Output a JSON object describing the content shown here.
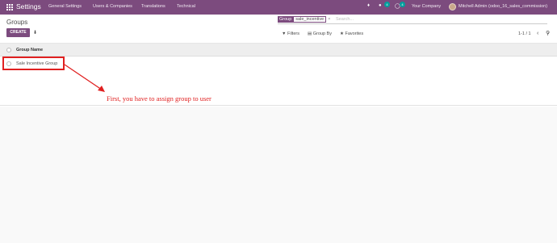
{
  "navbar": {
    "app_title": "Settings",
    "menu": [
      "General Settings",
      "Users & Companies",
      "Translations",
      "Technical"
    ],
    "chat_badge": "4",
    "activity_badge": "4",
    "company": "Your Company",
    "user": "Mitchell Admin (odoo_16_sales_commission)",
    "colors": {
      "brand": "#7c4b7e",
      "badge": "#00a09d"
    }
  },
  "control": {
    "breadcrumb": "Groups",
    "create_label": "CREATE",
    "search": {
      "facet_category": "Group",
      "facet_value": "sale_incentive",
      "facet_close": "×",
      "placeholder": "Search..."
    },
    "filters_label": "Filters",
    "groupby_label": "Group By",
    "favorites_label": "Favorites",
    "pager": "1-1 / 1"
  },
  "list": {
    "column_header": "Group Name",
    "rows": [
      "Sale Incentive Group"
    ]
  },
  "annotation": {
    "text": "First, you have to assign group to user",
    "color": "#e02020"
  },
  "icons": [
    "apps-icon",
    "bell-icon",
    "chat-icon",
    "clock-icon",
    "download-icon",
    "filter-icon",
    "group-by-icon",
    "star-icon",
    "search-icon",
    "chevron-left-icon",
    "chevron-right-icon"
  ]
}
